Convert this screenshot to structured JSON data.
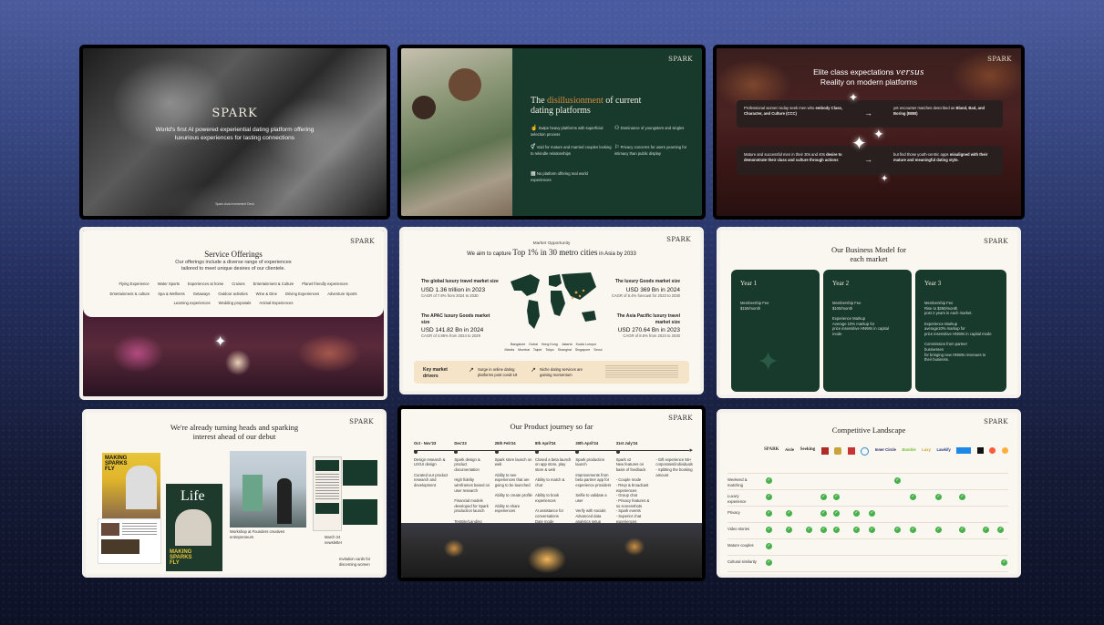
{
  "colors": {
    "accent_green": "#173a2d",
    "cream": "#faf7f0",
    "check_green": "#46b04a"
  },
  "logo": "SPARK",
  "slide1": {
    "title": "World's first AI powered experiential dating platform offering",
    "subtitle": "luxurious experiences for lasting connections",
    "footer": "Spark.Asia Investment Deck"
  },
  "slide2": {
    "title_prefix": "The",
    "title_highlight": "disillusionment",
    "title_suffix": "of current",
    "title_line2": "dating platforms",
    "points": [
      {
        "icon": "swipe-icon",
        "text": "Swipe heavy platforms with superficial selection process"
      },
      {
        "icon": "people-icon",
        "text": "Dominance of youngsters and singles"
      },
      {
        "icon": "gender-icon",
        "text": "Void for mature and married couples looking to rekindle relationships"
      },
      {
        "icon": "privacy-icon",
        "text": "Privacy concerns for users yearning for intimacy than public display"
      },
      {
        "icon": "grid-icon",
        "text": "No platform offering real world experiences"
      }
    ]
  },
  "slide3": {
    "title_a": "Elite class expectations",
    "title_versus": "versus",
    "title_b": "Reality on modern platforms",
    "rows": [
      {
        "left_pre": "Professional women today seek men who",
        "left_bold": "embody Class, Character, and Culture (CCC)",
        "right_pre": "yet encounter matches described as",
        "right_bold": "Bland, Bad, and Boring (BBB)"
      },
      {
        "left_pre": "Mature and successful men in their 30s and 40s",
        "left_bold": "desire to demonstrate their class and culture through actions",
        "right_pre": "but find those youth-centric apps",
        "right_bold": "misaligned with their mature and meaningful dating style."
      }
    ]
  },
  "slide4": {
    "title": "Service Offerings",
    "sub1": "Our offerings include a diverse range of experiences",
    "sub2": "tailored to meet unique desires of our clientele.",
    "row1": [
      "Flying Experience",
      "Water Sports",
      "Experiences at home",
      "Cruises",
      "Entertainment & Culture",
      "Planet friendly experiences"
    ],
    "row2": [
      "Entertainment & culture",
      "Spa & Wellness",
      "Getaways",
      "Outdoor activities",
      "Wine & Dine",
      "Driving Experiences",
      "Adventure Sports"
    ],
    "row3": [
      "Learning experiences",
      "Wedding proposals",
      "Animal Experiences"
    ]
  },
  "slide5": {
    "kicker": "Market Opportunity",
    "title_pre": "We aim to capture",
    "title_big": "Top 1% in 30 metro cities",
    "title_post": "in Asia by 2033",
    "left": [
      {
        "label": "The global luxury travel market size",
        "value": "USD 1.36 trillion in 2023",
        "cagr": "CAGR of 7.8% from 2024 to 2030"
      },
      {
        "label": "The APAC luxury Goods market size",
        "value": "USD 141.82 Bn in 2024",
        "cagr": "CAGR of 4.96% from 2024 to 2029"
      }
    ],
    "right": [
      {
        "label": "The luxury Goods market size",
        "value": "USD 369 Bn in 2024",
        "cagr": "CAGR of 5.4% forecast for 2023 to 2030"
      },
      {
        "label": "The Asia Pacific luxury travel market size",
        "value": "USD 270.64 Bn in 2023",
        "cagr": "CAGR of 8.6% from 2024 to 2030"
      }
    ],
    "cities1": [
      "Bangalore",
      "Dubai",
      "Hong Kong",
      "Jakarta",
      "Kuala Lumpur"
    ],
    "cities2": [
      "Manila",
      "Mumbai",
      "Taipei",
      "Tokyo",
      "Shanghai",
      "Singapore",
      "Seoul"
    ],
    "drivers_label": "Key market drivers",
    "driver1": "Surge in online dating platforms post covid-19",
    "driver2": "Niche dating services are gaining momentum"
  },
  "slide6": {
    "title": "Our Business Model for",
    "title2": "each market",
    "years": [
      {
        "name": "Year 1",
        "lines": [
          "Membership Fee",
          "$150/month"
        ]
      },
      {
        "name": "Year 2",
        "lines": [
          "Membership Fee",
          "$100/month",
          "",
          "Experience Markup",
          "Average 10% markup for",
          "price insensitive HNWIs in capital",
          "mode"
        ]
      },
      {
        "name": "Year 3",
        "lines": [
          "Membership Fee",
          "Rise to $250/month",
          "post 2 years in each market.",
          "",
          "Experience Markup",
          "average10% markup for",
          "price insensitive HNWIs in capital mode",
          "",
          "Commission from partner",
          "businesses",
          "for bringing new HNWIs revenues to",
          "their business."
        ]
      }
    ]
  },
  "slide7": {
    "title": "We're already turning heads and sparking",
    "title2": "interest ahead of our debut",
    "mag1": "MAKING SPARKS FLY",
    "mag2": "Life",
    "mag3": "MAKING SPARKS FLY",
    "caption1": "Workshop at Founders creatives entrepreneurs",
    "caption2": "March 24 newsletter",
    "caption3": "Invitation cards for discerning women"
  },
  "slide8": {
    "title": "Our Product journey so far",
    "dates": [
      "Oct - Nov'23",
      "Dec'23",
      "25th Feb'24",
      "8th April'24",
      "Cross a beta launch",
      "30th April'24",
      "31st July'24"
    ],
    "col_text": [
      "Design research & UX/UI design\n\nCurated our product research and development",
      "Spark design & product documentation\n\nHigh fidelity wireframes based on user research\n\nFinancial models developed for Spark production launch\n\nTestsite/Landing",
      "Spark store launch on web\n\nAbility to see experiences that are going to be launched\n\nAbility to create profile\n\nAbility to share experiences",
      "Closed a beta launch on app store, play store & web\n\nAbility to match & chat\n\nAbility to book experiences\n\nAI assistance for conversations\nDate mode\nAdvanced filters",
      "Spark production launch\n\nImprovements from beta partner app for experience providers\n\nSelfie to validate a user\n\nVerify with socials\nAdvanced data analytics setup",
      "Spark v2\nNew features on basis of feedback\n\n- Couple mode\n- Rsvp & broadcast experiences\n- Group chat\n- Privacy features & no screenshots\n- Spark events\n- Superior chat experiences\n- Video, voice call, voice notes",
      "- Gift experience 55+ corporates/individuals\n- Splitting the booking amount"
    ]
  },
  "slide9": {
    "title": "Competitive Landscape",
    "brands": [
      "SPARK",
      "Aisle",
      "Seeking",
      "Raya",
      "Hinge",
      "Inner Circle",
      "Bumble",
      "Luxy",
      "Elite Singles",
      "Lawkify",
      "The League",
      "Tinder",
      "Happn"
    ],
    "rows": [
      "Weekend & matching",
      "Luxury experience",
      "Privacy",
      "Video stories",
      "Mature couples",
      "Cultural similarity"
    ]
  }
}
